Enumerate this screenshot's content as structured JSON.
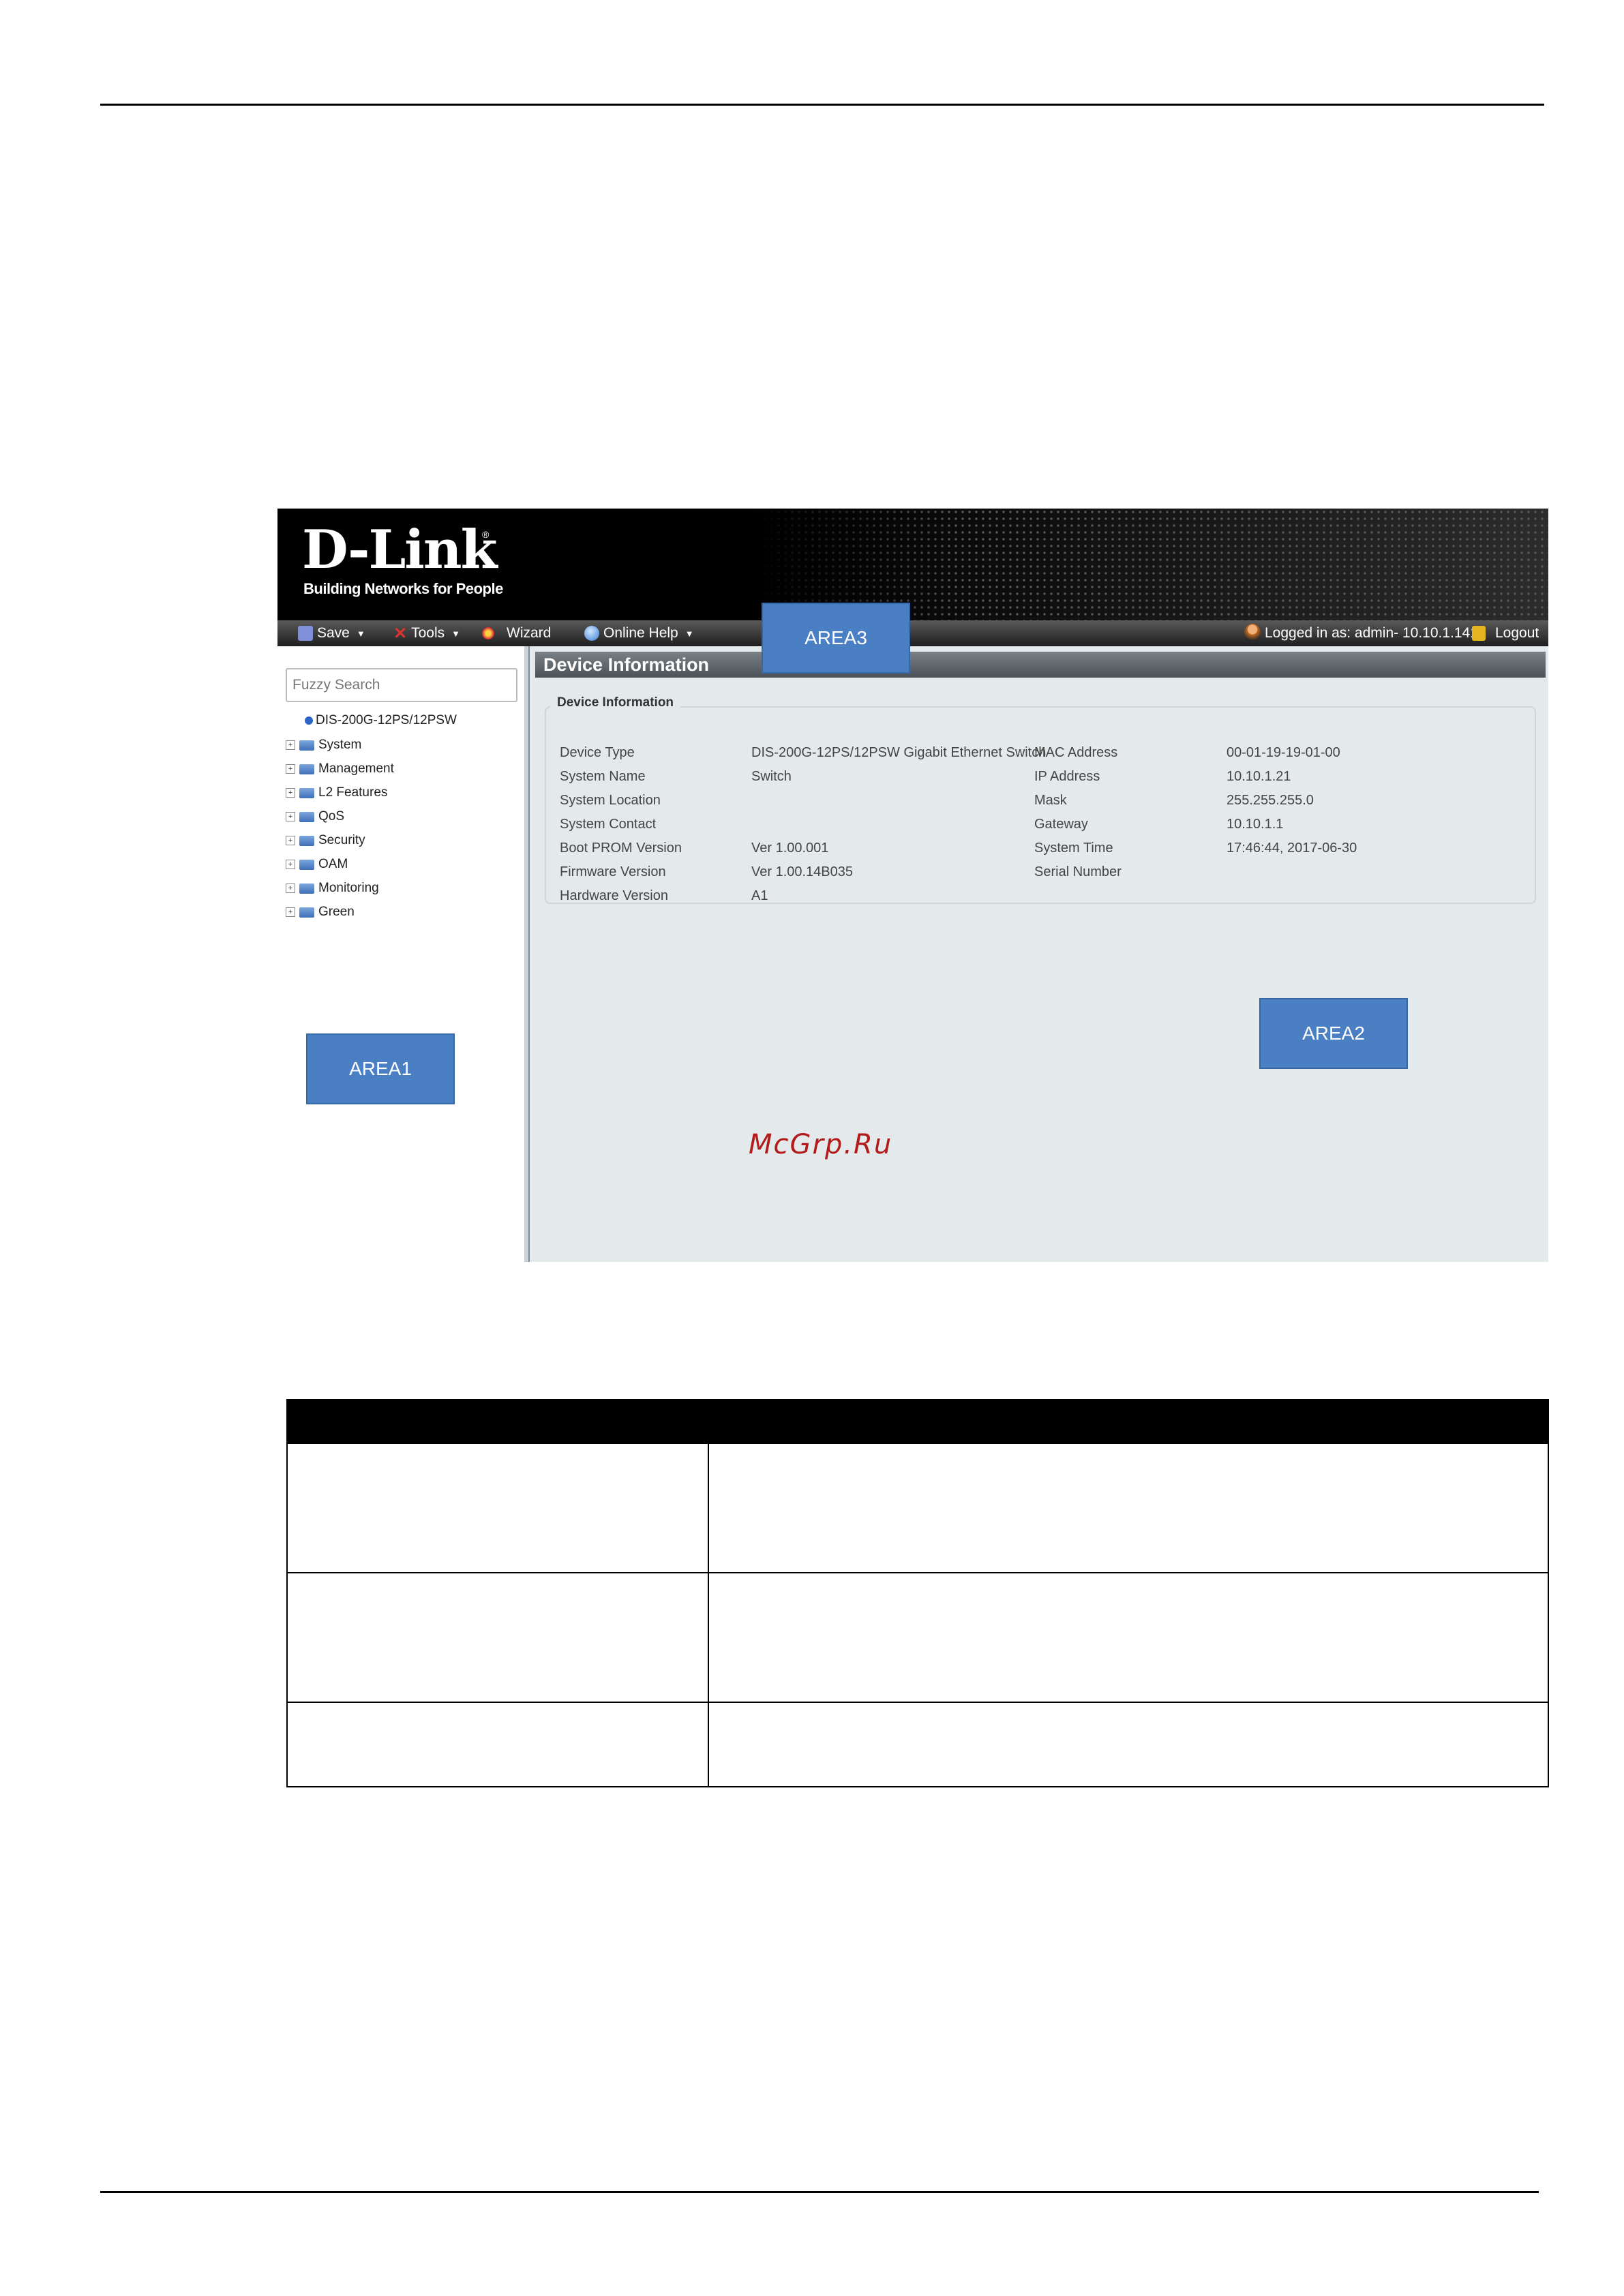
{
  "screenshot": {
    "logo": {
      "name": "D-Link",
      "reg_mark": "®",
      "tagline": "Building Networks for People"
    },
    "toolbar": {
      "save": "Save",
      "tools": "Tools",
      "wizard": "Wizard",
      "online_help": "Online Help",
      "logged_in": "Logged in as: admin- 10.10.1.141",
      "logout": "Logout"
    },
    "area_labels": {
      "area1": "AREA1",
      "area2": "AREA2",
      "area3": "AREA3"
    },
    "sidebar": {
      "search_placeholder": "Fuzzy Search",
      "root": "DIS-200G-12PS/12PSW",
      "items": [
        "System",
        "Management",
        "L2 Features",
        "QoS",
        "Security",
        "OAM",
        "Monitoring",
        "Green"
      ]
    },
    "panel": {
      "title": "Device Information",
      "legend": "Device Information",
      "left_fields": [
        {
          "label": "Device Type",
          "value": "DIS-200G-12PS/12PSW Gigabit Ethernet Switch"
        },
        {
          "label": "System Name",
          "value": "Switch"
        },
        {
          "label": "System Location",
          "value": ""
        },
        {
          "label": "System Contact",
          "value": ""
        },
        {
          "label": "Boot PROM Version",
          "value": "Ver 1.00.001"
        },
        {
          "label": "Firmware Version",
          "value": "Ver 1.00.14B035"
        },
        {
          "label": "Hardware Version",
          "value": "A1"
        }
      ],
      "right_fields": [
        {
          "label": "MAC Address",
          "value": "00-01-19-19-01-00"
        },
        {
          "label": "IP Address",
          "value": "10.10.1.21"
        },
        {
          "label": "Mask",
          "value": "255.255.255.0"
        },
        {
          "label": "Gateway",
          "value": "10.10.1.1"
        },
        {
          "label": "System Time",
          "value": "17:46:44, 2017-06-30"
        },
        {
          "label": "Serial Number",
          "value": ""
        }
      ]
    }
  },
  "watermark": "McGrp.Ru"
}
